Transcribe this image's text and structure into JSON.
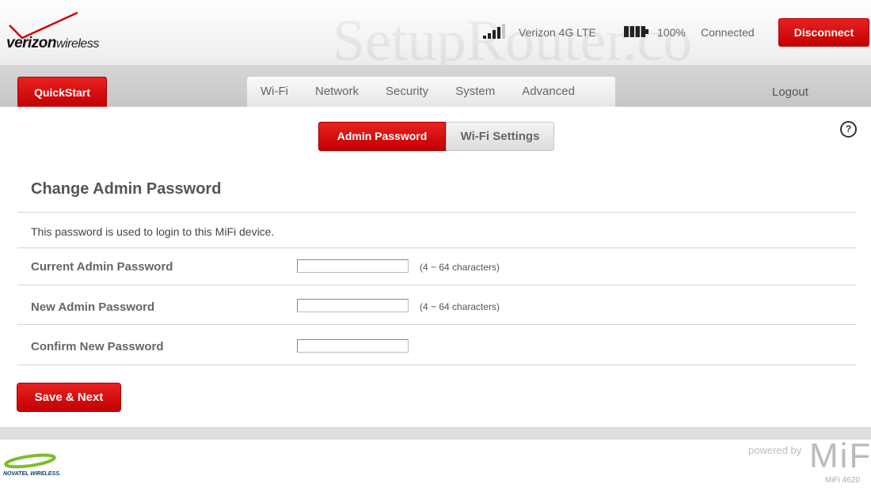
{
  "header": {
    "logo": {
      "brand": "verizon",
      "brand_sub": "wireless"
    },
    "watermark": "SetupRouter.co",
    "network": "Verizon 4G LTE",
    "battery_level": "100%",
    "connection_status": "Connected",
    "disconnect_label": "Disconnect"
  },
  "nav": {
    "quickstart_label": "QuickStart",
    "tabs": [
      "Wi-Fi",
      "Network",
      "Security",
      "System",
      "Advanced"
    ],
    "logout_label": "Logout"
  },
  "subtabs": [
    {
      "label": "Admin Password",
      "active": true
    },
    {
      "label": "Wi-Fi Settings",
      "active": false
    }
  ],
  "help_icon": "?",
  "form": {
    "title": "Change Admin Password",
    "description": "This password is used to login to this MiFi device.",
    "fields": [
      {
        "label": "Current Admin Password",
        "value": "",
        "hint": "(4 ~ 64 characters)"
      },
      {
        "label": "New Admin Password",
        "value": "",
        "hint": "(4 ~ 64 characters)"
      },
      {
        "label": "Confirm New Password",
        "value": ""
      }
    ],
    "save_label": "Save &  Next"
  },
  "footer": {
    "vendor": "NOVATEL WIRELESS.",
    "powered_by": "powered by",
    "product": "MiFi",
    "model": "MiFi 4620"
  },
  "colors": {
    "accent": "#d40000",
    "panel": "#ffffff",
    "nav": "#cccccc"
  }
}
